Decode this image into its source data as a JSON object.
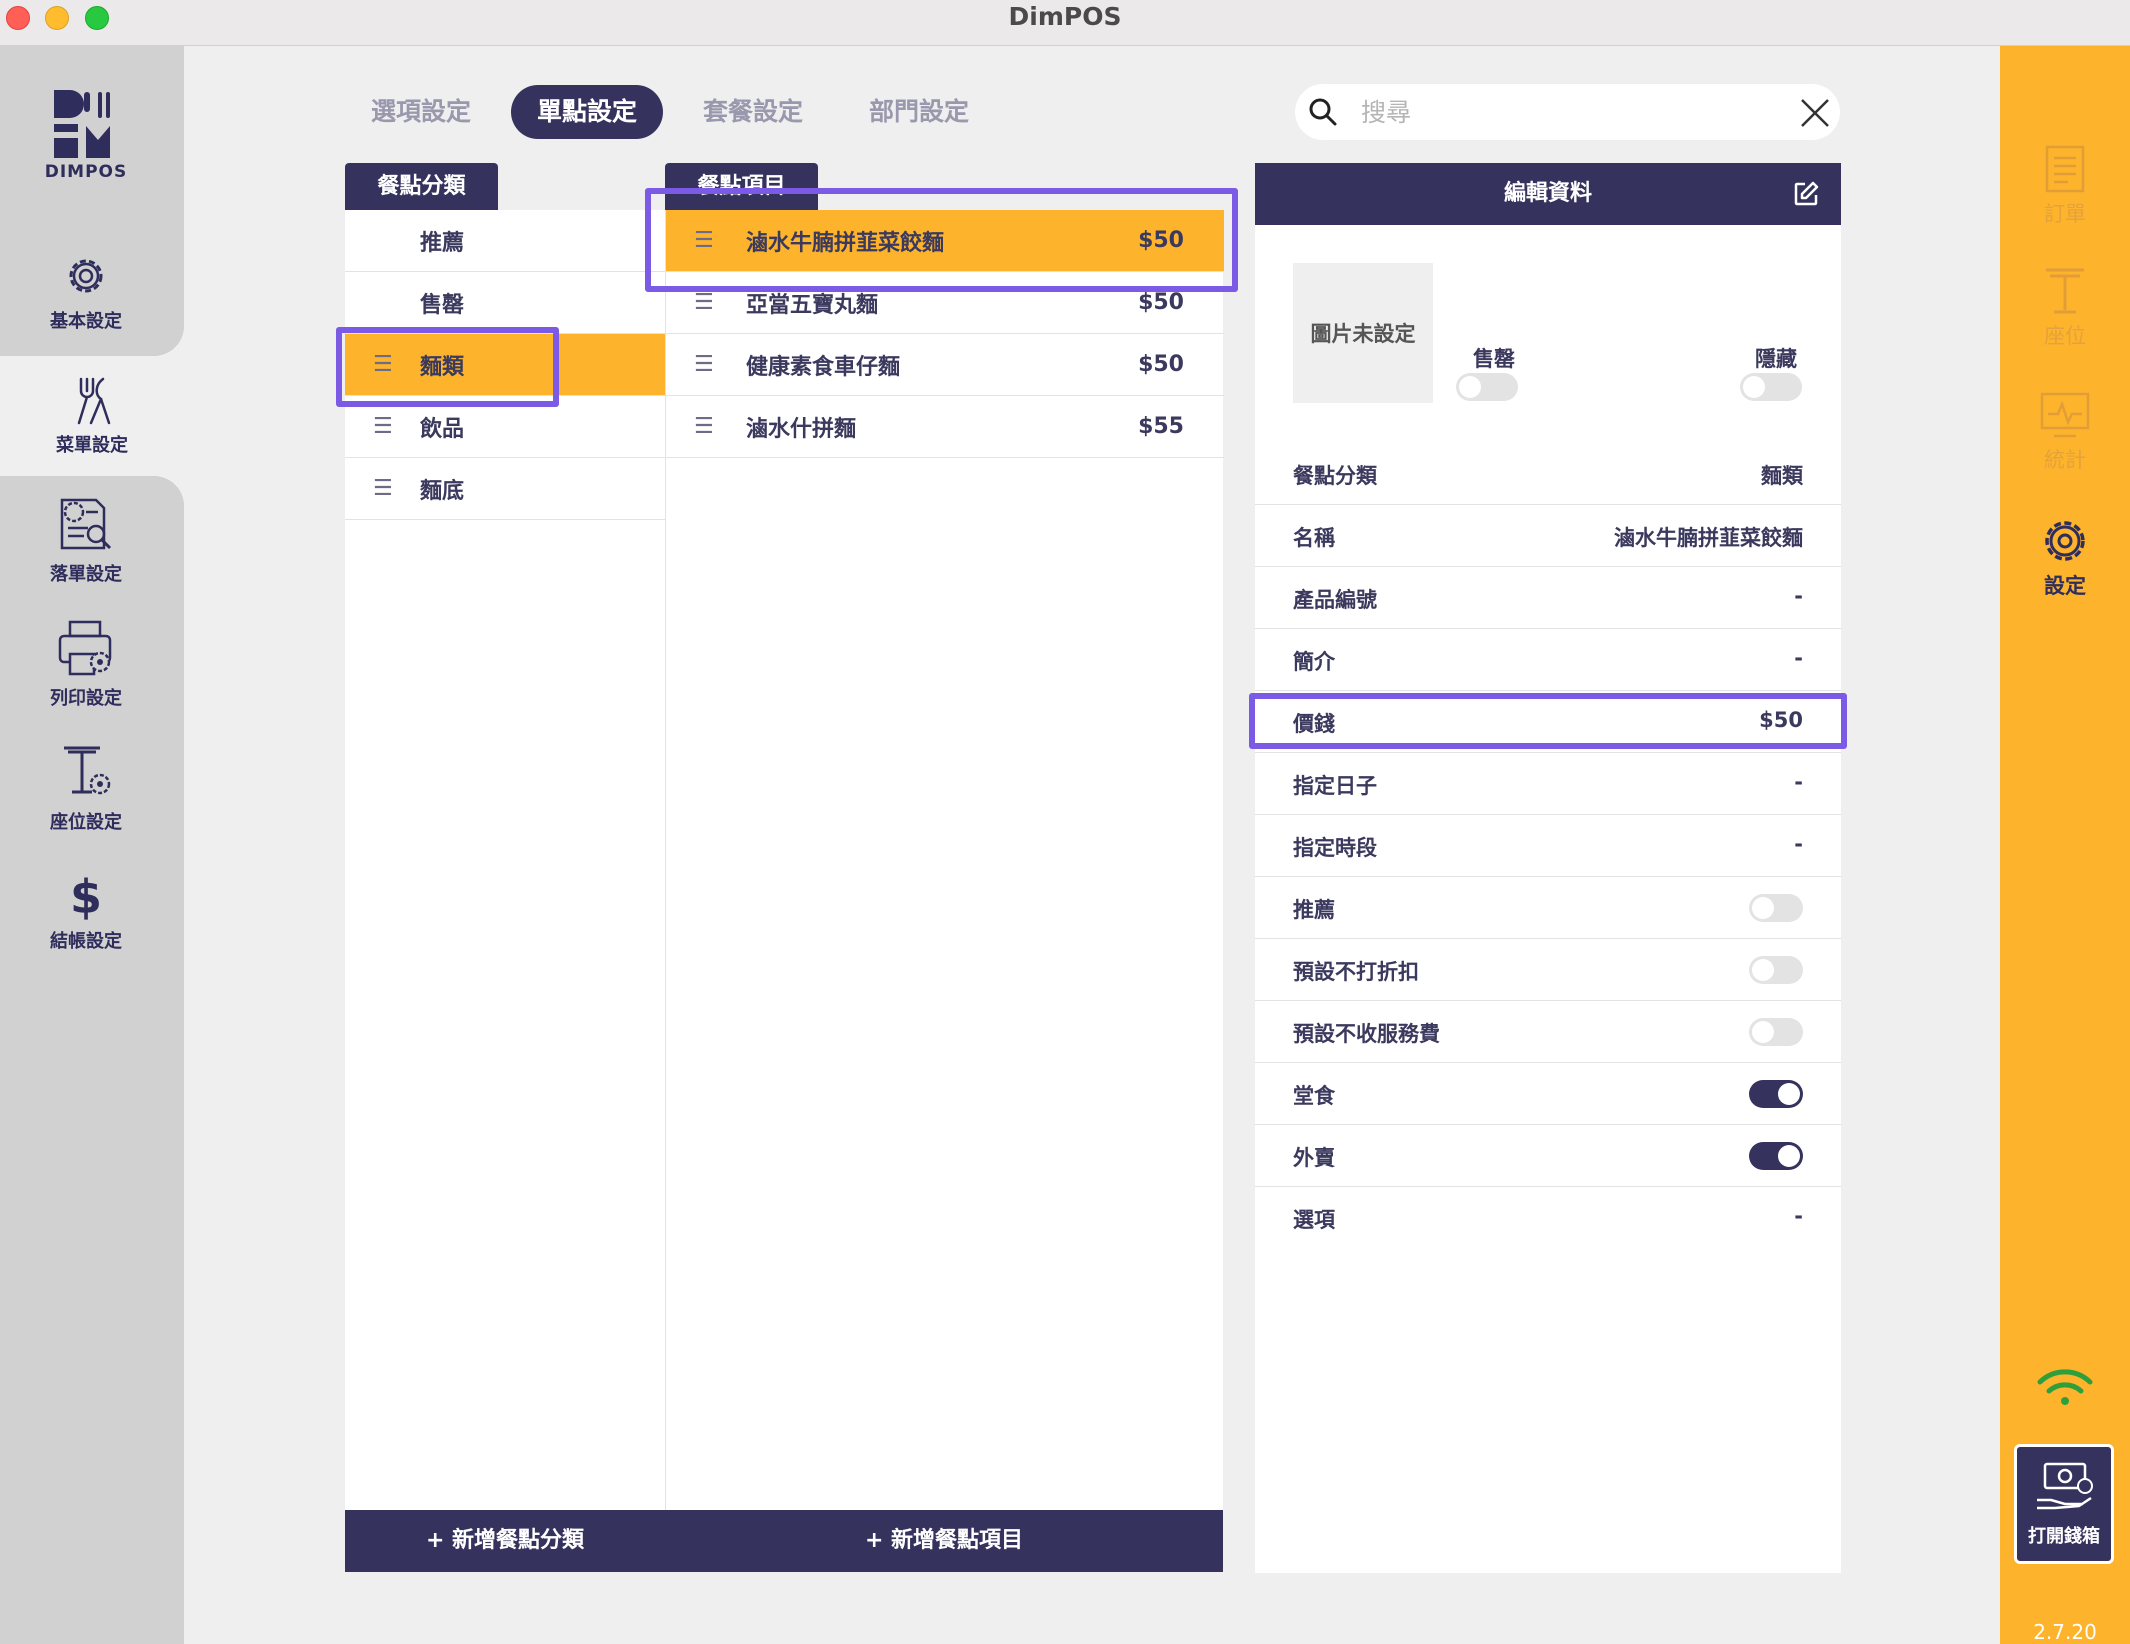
{
  "window": {
    "title": "DimPOS"
  },
  "brand": {
    "logo_text": "DIMPOS"
  },
  "left_nav": [
    {
      "label": "基本設定",
      "icon": "gear-icon"
    },
    {
      "label": "菜單設定",
      "icon": "fork-knife-icon"
    },
    {
      "label": "落單設定",
      "icon": "order-settings-icon"
    },
    {
      "label": "列印設定",
      "icon": "printer-icon"
    },
    {
      "label": "座位設定",
      "icon": "table-settings-icon"
    },
    {
      "label": "結帳設定",
      "icon": "dollar-icon"
    }
  ],
  "tabs": [
    "選項設定",
    "單點設定",
    "套餐設定",
    "部門設定"
  ],
  "active_tab": "單點設定",
  "search": {
    "placeholder": "搜尋",
    "value": ""
  },
  "categories": {
    "header": "餐點分類",
    "items": [
      "推薦",
      "售罄",
      "麵類",
      "飲品",
      "麵底"
    ],
    "selected": "麵類",
    "add_label": "+ 新增餐點分類"
  },
  "items": {
    "header": "餐點項目",
    "rows": [
      {
        "name": "滷水牛腩拼韮菜餃麵",
        "price": "$50"
      },
      {
        "name": "亞當五寶丸麵",
        "price": "$50"
      },
      {
        "name": "健康素食車仔麵",
        "price": "$50"
      },
      {
        "name": "滷水什拼麵",
        "price": "$55"
      }
    ],
    "add_label": "+ 新增餐點項目"
  },
  "detail": {
    "header": "編輯資料",
    "image_placeholder": "圖片未設定",
    "sold_out_label": "售罄",
    "hidden_label": "隱藏",
    "sold_out_on": false,
    "hidden_on": false,
    "fields": [
      {
        "key": "餐點分類",
        "value": "麵類"
      },
      {
        "key": "名稱",
        "value": "滷水牛腩拼韮菜餃麵"
      },
      {
        "key": "產品編號",
        "value": "-"
      },
      {
        "key": "簡介",
        "value": "-"
      },
      {
        "key": "價錢",
        "value": "$50"
      },
      {
        "key": "指定日子",
        "value": "-"
      },
      {
        "key": "指定時段",
        "value": "-"
      }
    ],
    "toggles": [
      {
        "key": "推薦",
        "on": false
      },
      {
        "key": "預設不打折扣",
        "on": false
      },
      {
        "key": "預設不收服務費",
        "on": false
      },
      {
        "key": "堂食",
        "on": true
      },
      {
        "key": "外賣",
        "on": true
      }
    ],
    "options": {
      "key": "選項",
      "value": "-"
    }
  },
  "right_nav": [
    {
      "label": "訂單",
      "icon": "receipt-icon"
    },
    {
      "label": "座位",
      "icon": "table-icon"
    },
    {
      "label": "統計",
      "icon": "stats-icon"
    },
    {
      "label": "設定",
      "icon": "gear-icon"
    }
  ],
  "cashbox": {
    "label": "打開錢箱"
  },
  "version": "2.7.20",
  "colors": {
    "navy": "#35335e",
    "orange": "#fdb42c",
    "highlight": "#7b5ae6"
  }
}
